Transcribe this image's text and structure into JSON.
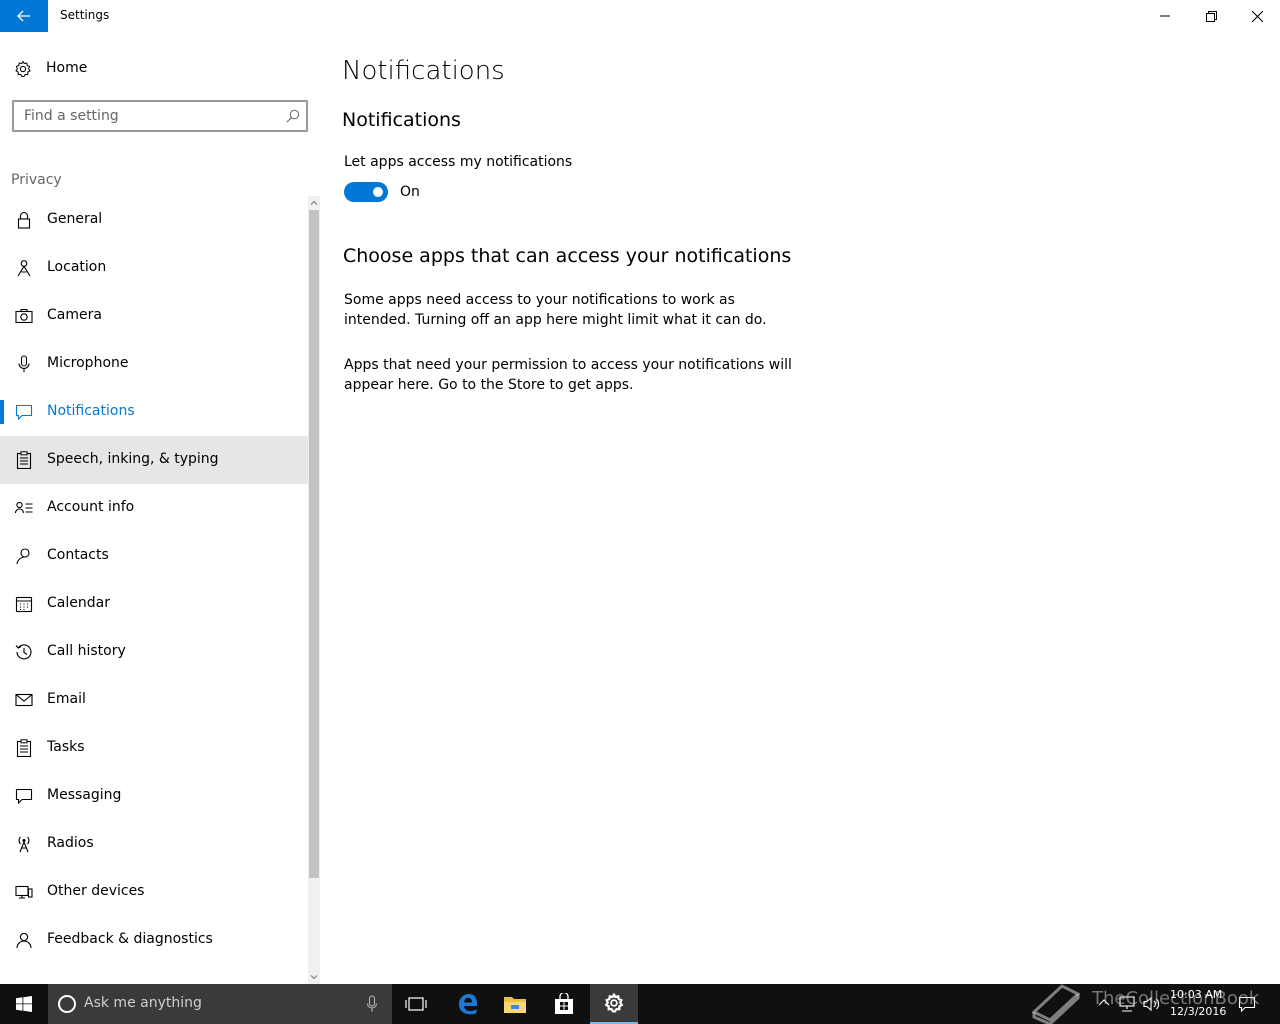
{
  "window": {
    "title": "Settings",
    "accent": "#0078d7"
  },
  "sidebar": {
    "home_label": "Home",
    "search_placeholder": "Find a setting",
    "section_label": "Privacy",
    "items": [
      {
        "label": "General",
        "icon": "lock-icon"
      },
      {
        "label": "Location",
        "icon": "location-icon"
      },
      {
        "label": "Camera",
        "icon": "camera-icon"
      },
      {
        "label": "Microphone",
        "icon": "microphone-icon"
      },
      {
        "label": "Notifications",
        "icon": "notification-icon",
        "selected": true
      },
      {
        "label": "Speech, inking, & typing",
        "icon": "clipboard-icon",
        "hover": true
      },
      {
        "label": "Account info",
        "icon": "account-info-icon"
      },
      {
        "label": "Contacts",
        "icon": "contacts-icon"
      },
      {
        "label": "Calendar",
        "icon": "calendar-icon"
      },
      {
        "label": "Call history",
        "icon": "history-icon"
      },
      {
        "label": "Email",
        "icon": "mail-icon"
      },
      {
        "label": "Tasks",
        "icon": "tasks-icon"
      },
      {
        "label": "Messaging",
        "icon": "message-icon"
      },
      {
        "label": "Radios",
        "icon": "radio-icon"
      },
      {
        "label": "Other devices",
        "icon": "devices-icon"
      },
      {
        "label": "Feedback & diagnostics",
        "icon": "feedback-icon"
      }
    ]
  },
  "main": {
    "page_title": "Notifications",
    "section_heading": "Notifications",
    "toggle_label": "Let apps access my notifications",
    "toggle_state": "On",
    "choose_heading": "Choose apps that can access your notifications",
    "para1": "Some apps need access to your notifications to work as intended. Turning off an app here might limit what it can do.",
    "para2": "Apps that need your permission to access your notifications will appear here. Go to the Store to get apps."
  },
  "taskbar": {
    "search_placeholder": "Ask me anything",
    "apps": [
      "task-view-icon",
      "edge-icon",
      "file-explorer-icon",
      "store-icon",
      "settings-icon"
    ],
    "time": "10:03 AM",
    "date": "12/3/2016",
    "watermark": "TheCollectionBook"
  }
}
